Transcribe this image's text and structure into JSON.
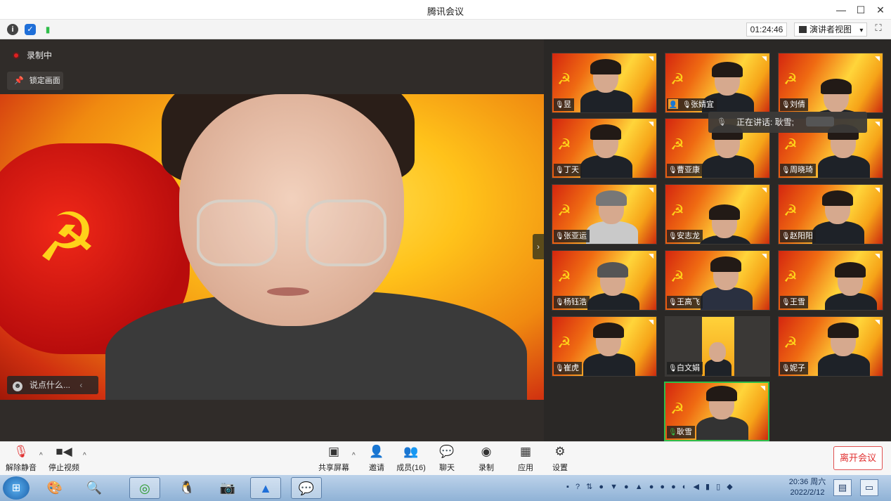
{
  "window": {
    "title": "腾讯会议",
    "controls": {
      "minimize": "—",
      "maximize": "☐",
      "close": "✕"
    }
  },
  "infobar": {
    "timer": "01:24:46",
    "view_label": "演讲者视图",
    "view_caret": "▾",
    "icons": [
      "info-icon",
      "shield-icon",
      "signal-icon"
    ]
  },
  "stage": {
    "recording": "录制中",
    "lock": "锁定画面",
    "chat_placeholder": "说点什么...",
    "chat_caret": "‹"
  },
  "speaking_tooltip": {
    "label": "正在讲话: 耿雪;"
  },
  "participants": [
    {
      "name": "昱"
    },
    {
      "name": "张婧宜"
    },
    {
      "name": "刘倩"
    },
    {
      "name": "丁天"
    },
    {
      "name": "曹亚康"
    },
    {
      "name": "周晓琦"
    },
    {
      "name": "张亚运"
    },
    {
      "name": "安志龙"
    },
    {
      "name": "赵阳阳"
    },
    {
      "name": "杨钰浩"
    },
    {
      "name": "王高飞"
    },
    {
      "name": "王雪"
    },
    {
      "name": "崔虎"
    },
    {
      "name": "白文娟"
    },
    {
      "name": "妮子"
    },
    {
      "name": "耿雪"
    }
  ],
  "toolbar": {
    "unmute": "解除静音",
    "stop_video": "停止视频",
    "share": "共享屏幕",
    "invite": "邀请",
    "members": "成员(16)",
    "chat": "聊天",
    "record": "录制",
    "apps": "应用",
    "settings": "设置",
    "leave": "离开会议"
  },
  "taskbar": {
    "time": "20:36 周六",
    "date": "2022/2/12"
  },
  "colors": {
    "accent_green": "#2fbd49",
    "leave_red": "#e03030",
    "record_red": "#e02020"
  }
}
